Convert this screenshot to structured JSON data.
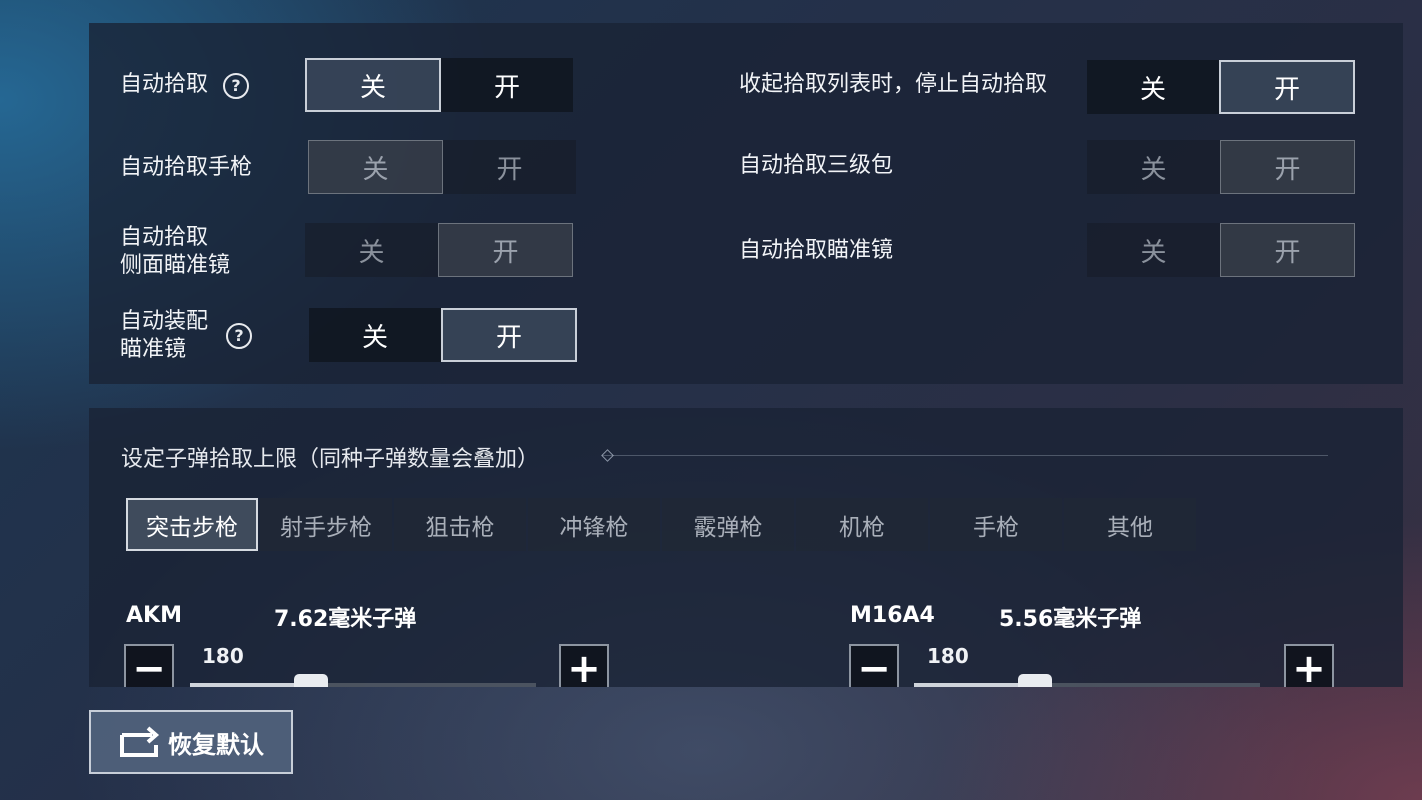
{
  "pickup_settings": [
    {
      "label": "自动拾取",
      "has_help": true,
      "off": "关",
      "on": "开",
      "value": "off",
      "enabled": true
    },
    {
      "label": "自动拾取手枪",
      "has_help": false,
      "off": "关",
      "on": "开",
      "value": "off",
      "enabled": false
    },
    {
      "label": "自动拾取\n侧面瞄准镜",
      "has_help": false,
      "off": "关",
      "on": "开",
      "value": "on",
      "enabled": false
    },
    {
      "label": "自动装配\n瞄准镜",
      "has_help": true,
      "off": "关",
      "on": "开",
      "value": "on",
      "enabled": true
    },
    {
      "label": "收起拾取列表时，停止自动拾取",
      "has_help": false,
      "off": "关",
      "on": "开",
      "value": "on",
      "enabled": true
    },
    {
      "label": "自动拾取三级包",
      "has_help": false,
      "off": "关",
      "on": "开",
      "value": "on",
      "enabled": false
    },
    {
      "label": "自动拾取瞄准镜",
      "has_help": false,
      "off": "关",
      "on": "开",
      "value": "on",
      "enabled": false
    }
  ],
  "ammo_section": {
    "title": "设定子弹拾取上限（同种子弹数量会叠加）",
    "tabs": [
      "突击步枪",
      "射手步枪",
      "狙击枪",
      "冲锋枪",
      "霰弹枪",
      "机枪",
      "手枪",
      "其他"
    ],
    "active_tab": 0,
    "weapons": [
      {
        "gun": "AKM",
        "ammo": "7.62毫米子弹",
        "count": "180",
        "fill_fraction": 0.35
      },
      {
        "gun": "M16A4",
        "ammo": "5.56毫米子弹",
        "count": "180",
        "fill_fraction": 0.35
      }
    ]
  },
  "reset_label": "恢复默认",
  "icons": {
    "help": "?",
    "minus": "−",
    "plus": "+"
  }
}
